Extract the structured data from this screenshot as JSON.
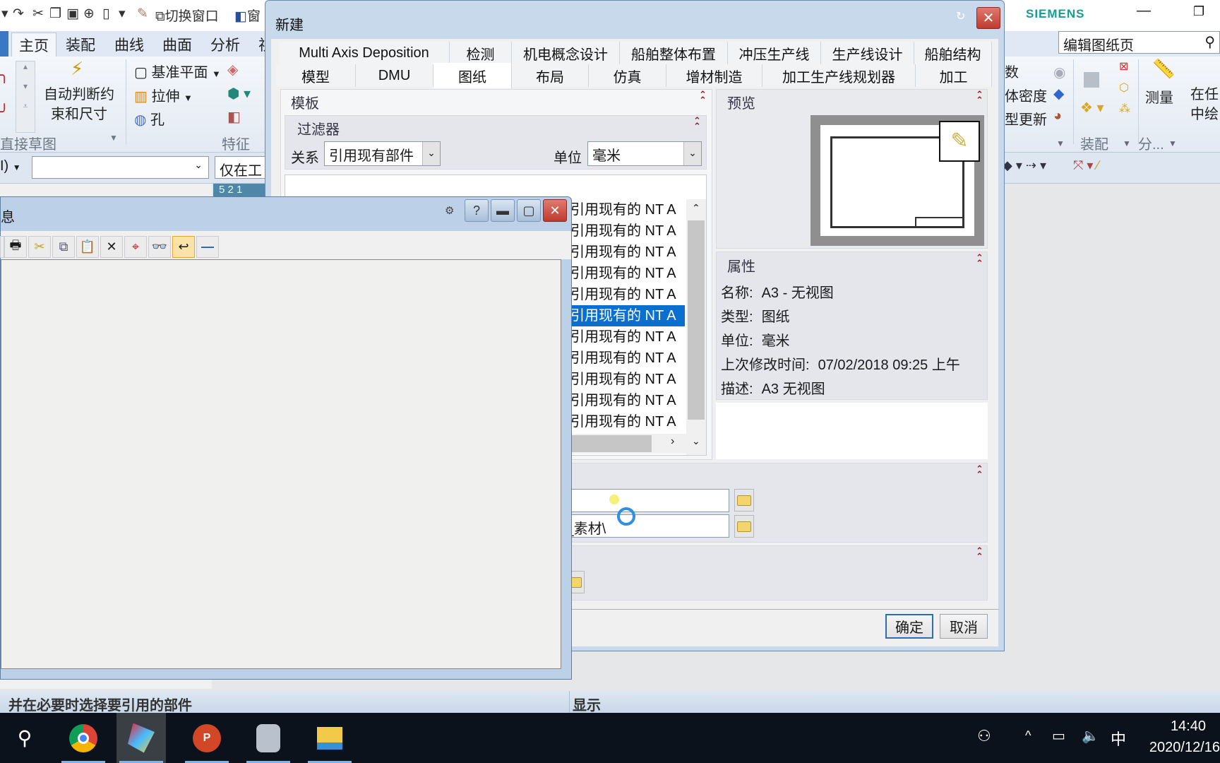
{
  "quick_access": {
    "switch_window": "切换窗口",
    "window": "窗"
  },
  "ribbon": {
    "tabs": [
      "主页",
      "装配",
      "曲线",
      "曲面",
      "分析",
      "视"
    ],
    "selected_tab": "主页",
    "auto_constraint": [
      "自动判断约",
      "束和尺寸"
    ],
    "datum_plane": "基准平面",
    "extrude": "拉伸",
    "hole": "孔",
    "group_sketch": "直接草图",
    "group_feature": "特征",
    "right_items": [
      "数",
      "体密度",
      "型更新"
    ],
    "measure": "测量",
    "in_any": [
      "在任",
      "中绘"
    ],
    "group_assembly": "装配",
    "group_analysis": "分...",
    "search_value": "编辑图纸页",
    "brand": "SIEMENS"
  },
  "toolbar2": {
    "combo_prefix": "I)",
    "combo_value": "",
    "filter": "仅在工"
  },
  "graphics": {
    "tab_fragment": "5 2 1"
  },
  "new_dialog": {
    "title": "新建",
    "tabs_row1": [
      "Multi Axis Deposition",
      "检测",
      "机电概念设计",
      "船舶整体布置",
      "冲压生产线",
      "生产线设计",
      "船舶结构"
    ],
    "tabs_row2": [
      "模型",
      "DMU",
      "图纸",
      "布局",
      "仿真",
      "增材制造",
      "加工生产线规划器",
      "加工"
    ],
    "selected_tab": "图纸",
    "template_section": "模板",
    "filter_section": "过滤器",
    "relation_label": "关系",
    "relation_value": "引用现有部件",
    "unit_label": "单位",
    "unit_value": "毫米",
    "template_list": [
      "引用现有的 NT A",
      "引用现有的 NT A",
      "引用现有的 NT A",
      "引用现有的 NT A",
      "引用现有的 NT A",
      "引用现有的 NT A",
      "引用现有的 NT A",
      "引用现有的 NT A",
      "引用现有的 NT A",
      "引用现有的 NT A",
      "引用现有的 NT A"
    ],
    "selected_index": 5,
    "preview_section": "预览",
    "properties_section": "属性",
    "properties": [
      {
        "label": "名称:",
        "value": "A3 - 无视图"
      },
      {
        "label": "类型:",
        "value": "图纸"
      },
      {
        "label": "单位:",
        "value": "毫米"
      },
      {
        "label": "上次修改时间:",
        "value": "07/02/2018 09:25 上午"
      },
      {
        "label": "描述:",
        "value": "A3 无视图"
      }
    ],
    "name_field": "",
    "folder_field": "l_素材\\",
    "ok": "确定",
    "cancel": "取消"
  },
  "info_window": {
    "title": "息"
  },
  "status": {
    "left": "并在必要时选择要引用的部件",
    "right": "显示"
  },
  "taskbar": {
    "time": "14:40",
    "date": "2020/12/16",
    "ime": "中"
  },
  "colors": {
    "selection": "#0a6fcf",
    "close": "#c8433a",
    "brand": "#1a9c95"
  }
}
